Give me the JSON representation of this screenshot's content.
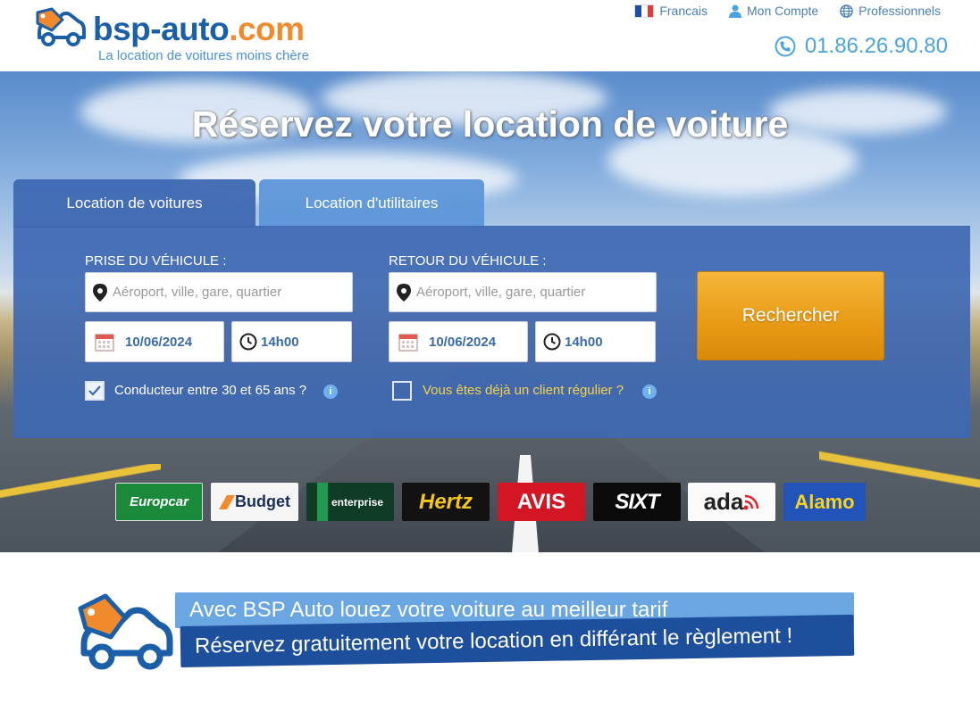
{
  "header": {
    "logo": {
      "part1": "bsp-auto",
      "part2": ".com"
    },
    "tagline": "La location de voitures moins chère",
    "links": [
      {
        "label": "Francais",
        "icon": "french-flag-icon"
      },
      {
        "label": "Mon Compte",
        "icon": "user-icon"
      },
      {
        "label": "Professionnels",
        "icon": "globe-icon"
      }
    ],
    "phone": "01.86.26.90.80"
  },
  "hero": {
    "title": "Réservez votre location de voiture"
  },
  "tabs": [
    {
      "label": "Location de voitures",
      "active": true
    },
    {
      "label": "Location d'utilitaires",
      "active": false
    }
  ],
  "form": {
    "pickup": {
      "label": "PRISE DU VÉHICULE :",
      "placeholder": "Aéroport, ville, gare, quartier",
      "date": "10/06/2024",
      "time": "14h00"
    },
    "return": {
      "label": "RETOUR DU VÉHICULE :",
      "placeholder": "Aéroport, ville, gare, quartier",
      "date": "10/06/2024",
      "time": "14h00"
    },
    "driver_age": {
      "label": "Conducteur entre 30 et 65 ans ?",
      "checked": true
    },
    "regular_client": {
      "label": "Vous êtes déjà un client régulier ?",
      "checked": false
    },
    "search_label": "Rechercher"
  },
  "brands": [
    "Europcar",
    "Budget",
    "enterprise",
    "Hertz",
    "AVIS",
    "SIXT",
    "ada",
    "Alamo"
  ],
  "promo": {
    "line1": "Avec BSP Auto louez votre voiture au meilleur tarif",
    "line2": "Réservez gratuitement votre location en différant le règlement !"
  },
  "colors": {
    "brand_blue": "#1b5fa8",
    "brand_orange": "#f08a2c",
    "panel_blue": "#3e68b2",
    "search_orange": "#e89a14",
    "link_blue": "#4a7fb5"
  }
}
